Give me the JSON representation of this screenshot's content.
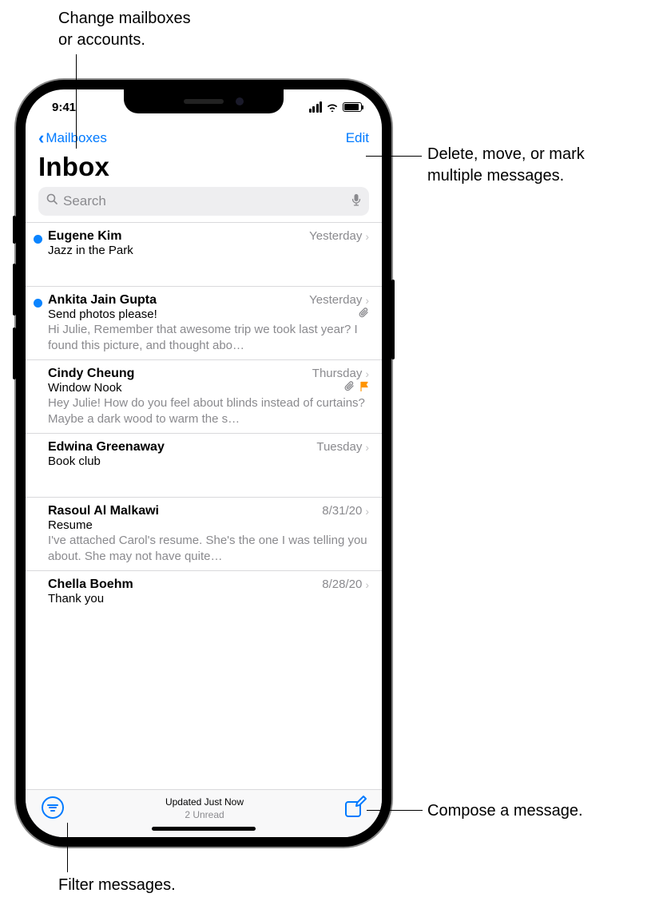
{
  "status": {
    "time": "9:41"
  },
  "nav": {
    "back_label": "Mailboxes",
    "edit_label": "Edit"
  },
  "title": "Inbox",
  "search": {
    "placeholder": "Search"
  },
  "messages": [
    {
      "sender": "Eugene Kim",
      "date": "Yesterday",
      "subject": "Jazz in the Park",
      "preview": "",
      "unread": true,
      "attachment": false,
      "flagged": false
    },
    {
      "sender": "Ankita Jain Gupta",
      "date": "Yesterday",
      "subject": "Send photos please!",
      "preview": "Hi Julie, Remember that awesome trip we took last year? I found this picture, and thought abo…",
      "unread": true,
      "attachment": true,
      "flagged": false
    },
    {
      "sender": "Cindy Cheung",
      "date": "Thursday",
      "subject": "Window Nook",
      "preview": "Hey Julie! How do you feel about blinds instead of curtains? Maybe a dark wood to warm the s…",
      "unread": false,
      "attachment": true,
      "flagged": true
    },
    {
      "sender": "Edwina Greenaway",
      "date": "Tuesday",
      "subject": "Book club",
      "preview": "",
      "unread": false,
      "attachment": false,
      "flagged": false
    },
    {
      "sender": "Rasoul Al Malkawi",
      "date": "8/31/20",
      "subject": "Resume",
      "preview": "I've attached Carol's resume. She's the one I was telling you about. She may not have quite…",
      "unread": false,
      "attachment": false,
      "flagged": false
    },
    {
      "sender": "Chella Boehm",
      "date": "8/28/20",
      "subject": "Thank you",
      "preview": "",
      "unread": false,
      "attachment": false,
      "flagged": false
    }
  ],
  "toolbar": {
    "updated": "Updated Just Now",
    "unread": "2 Unread"
  },
  "callouts": {
    "top_left": "Change mailboxes\nor accounts.",
    "top_right": "Delete, move, or mark\nmultiple messages.",
    "bottom_right": "Compose a message.",
    "bottom_left": "Filter messages."
  }
}
